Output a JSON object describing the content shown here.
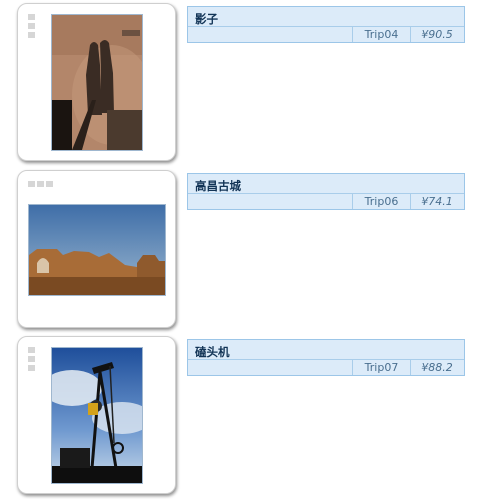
{
  "items": [
    {
      "title": "影子",
      "code": "Trip04",
      "price": "¥90.5"
    },
    {
      "title": "高昌古城",
      "code": "Trip06",
      "price": "¥74.1"
    },
    {
      "title": "磕头机",
      "code": "Trip07",
      "price": "¥88.2"
    }
  ]
}
